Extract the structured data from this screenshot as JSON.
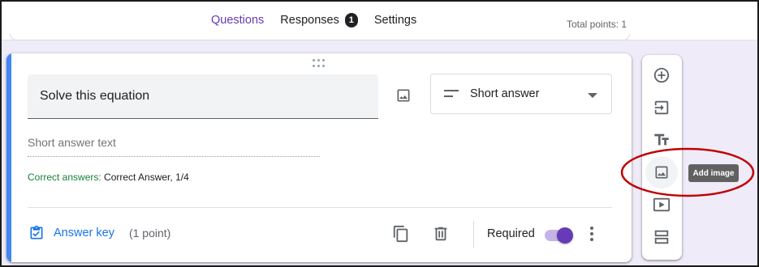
{
  "header": {
    "tabs": [
      {
        "label": "Questions",
        "active": true
      },
      {
        "label": "Responses",
        "badge": "1"
      },
      {
        "label": "Settings"
      }
    ],
    "total_points": "Total points: 1"
  },
  "question": {
    "title": "Solve this equation",
    "type_label": "Short answer",
    "answer_placeholder": "Short answer text",
    "correct_answers_label": "Correct answers: ",
    "correct_answers_value": "Correct Answer, 1/4",
    "answer_key_label": "Answer key",
    "points_label": "(1 point)",
    "required_label": "Required",
    "required": true
  },
  "side_toolbar": {
    "items": [
      {
        "icon": "add-circle-icon"
      },
      {
        "icon": "import-questions-icon"
      },
      {
        "icon": "title-text-icon"
      },
      {
        "icon": "add-image-icon"
      },
      {
        "icon": "video-icon"
      },
      {
        "icon": "section-icon"
      }
    ],
    "tooltip": "Add image"
  },
  "colors": {
    "accent": "#673ab7",
    "card_accent": "#4285f4",
    "link": "#1a73e8",
    "correct": "#188038",
    "annotation": "#c00000"
  }
}
